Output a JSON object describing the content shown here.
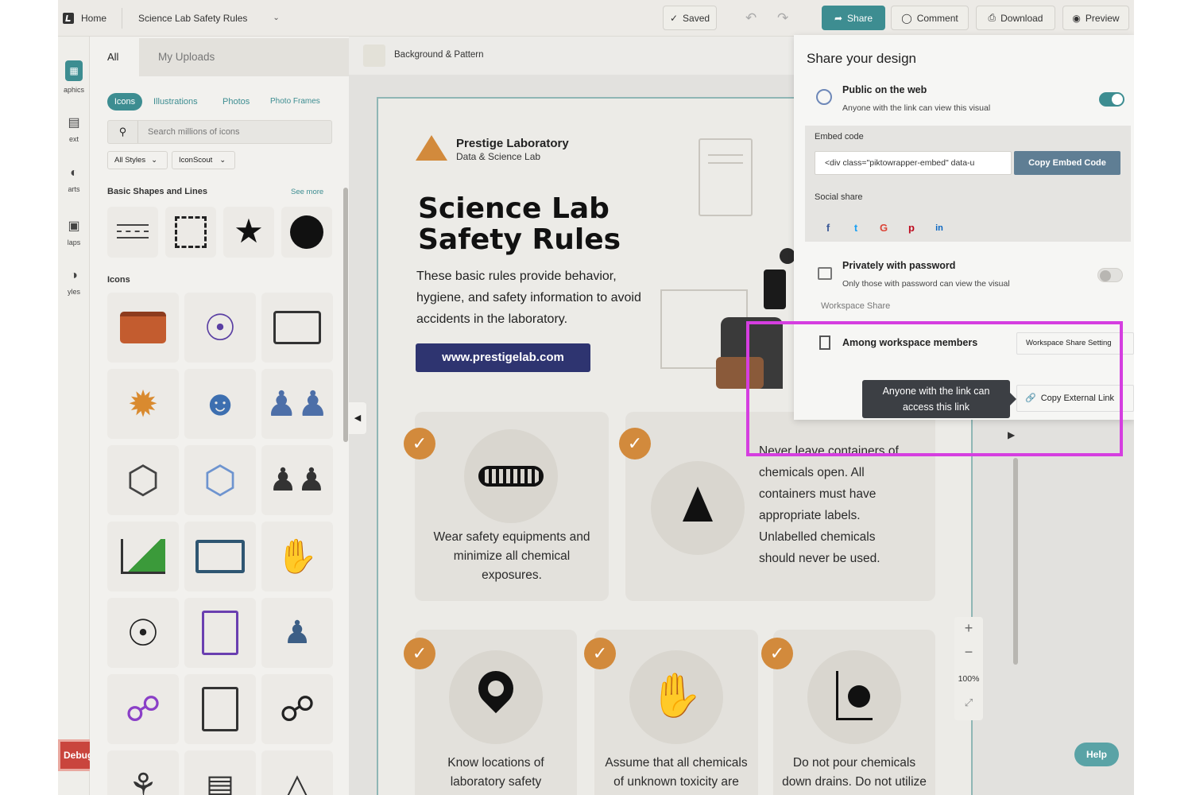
{
  "topbar": {
    "home_label": "Home",
    "doc_title": "Science Lab Safety Rules",
    "saved_label": "Saved",
    "share_label": "Share",
    "comment_label": "Comment",
    "download_label": "Download",
    "preview_label": "Preview"
  },
  "rail": {
    "items": [
      {
        "label": "aphics"
      },
      {
        "label": "ext"
      },
      {
        "label": "arts"
      },
      {
        "label": "laps"
      },
      {
        "label": "yles"
      }
    ],
    "debug_label": "Debug"
  },
  "panel": {
    "tab_all": "All",
    "tab_uploads": "My Uploads",
    "chips": [
      "Icons",
      "Illustrations",
      "Photos",
      "Photo Frames"
    ],
    "search_placeholder": "Search millions of icons",
    "filter_styles": "All Styles",
    "filter_source": "IconScout",
    "basic_heading": "Basic Shapes and Lines",
    "see_more": "See more",
    "icons_heading": "Icons"
  },
  "canvas": {
    "bg_pattern_label": "Background & Pattern",
    "zoom_level": "100%",
    "help_label": "Help"
  },
  "poster": {
    "org_name": "Prestige Laboratory",
    "org_sub": "Data & Science Lab",
    "title_line1": "Science Lab",
    "title_line2": "Safety Rules",
    "intro": "These basic rules provide behavior, hygiene, and safety information to avoid accidents in the laboratory.",
    "url": "www.prestigelab.com",
    "card1": "Wear safety equipments and minimize all chemical exposures.",
    "card2": "Never leave containers of chemicals open. All containers must have appropriate labels. Unlabelled chemicals should never be used.",
    "card3": "Know locations of laboratory safety showers and fire",
    "card4": "Assume that all chemicals of unknown toxicity are highly",
    "card5": "Do not pour chemicals down drains. Do not utilize the"
  },
  "share": {
    "title": "Share your design",
    "public_title": "Public on the web",
    "public_sub": "Anyone with the link can view this visual",
    "public_on": true,
    "embed_label": "Embed code",
    "embed_value": "<div class=\"piktowrapper-embed\" data-u",
    "copy_embed": "Copy Embed Code",
    "social_label": "Social share",
    "social": [
      "f",
      "t",
      "G",
      "p",
      "in"
    ],
    "private_title": "Privately with password",
    "private_sub": "Only those with password can view the visual",
    "private_on": false,
    "workspace_label": "Workspace Share",
    "among_label": "Among workspace members",
    "workspace_setting": "Workspace Share Setting",
    "tooltip": "Anyone with the link can access this link",
    "copy_external": "Copy External Link"
  },
  "colors": {
    "share_accent": "#3d8d91",
    "highlight": "#d53ee0",
    "check_orange": "#d28a3c",
    "url_button": "#2e3470"
  }
}
